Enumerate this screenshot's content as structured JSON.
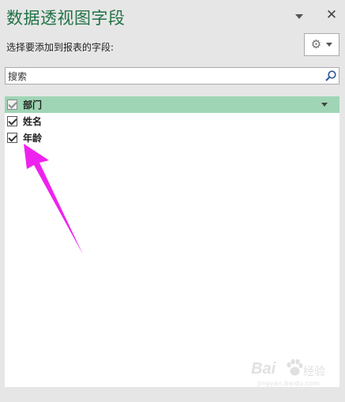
{
  "pane": {
    "title": "数据透视图字段",
    "instruction": "选择要添加到报表的字段:"
  },
  "search": {
    "placeholder": "搜索",
    "value": ""
  },
  "fields": [
    {
      "label": "部门",
      "checked": true,
      "highlighted": true
    },
    {
      "label": "姓名",
      "checked": true,
      "highlighted": false
    },
    {
      "label": "年龄",
      "checked": true,
      "highlighted": false
    }
  ],
  "icons": {
    "pane_menu": "chevron-down-icon",
    "close": "close-icon",
    "tools": "gear-icon",
    "search": "search-icon"
  },
  "colors": {
    "title": "#217346",
    "highlight_row": "#9fd5b5",
    "annotation_arrow": "#ee22ee",
    "panel_background": "#e6e6e6"
  },
  "watermark": {
    "brand_latin": "Bai",
    "brand_cn": "经验",
    "url": "jingyan.baidu.com"
  }
}
